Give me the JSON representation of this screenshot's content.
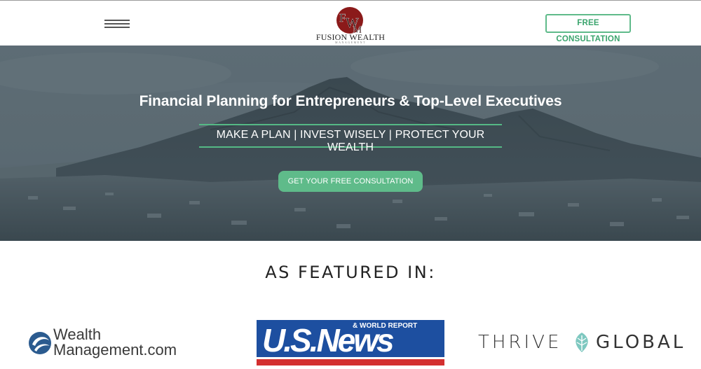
{
  "header": {
    "menu_icon": "hamburger-menu-icon",
    "logo": {
      "monogram": "FWM",
      "name": "FUSION WEALTH",
      "subtitle": "MANAGEMENT",
      "color": "#8b1a1a"
    },
    "cta_label": "FREE CONSULTATION"
  },
  "hero": {
    "title": "Financial Planning for Entrepreneurs & Top-Level Executives",
    "tagline": "MAKE A PLAN | INVEST WISELY | PROTECT YOUR WEALTH",
    "cta_label": "GET YOUR FREE CONSULTATION",
    "accent_color": "#5fbb8a"
  },
  "featured": {
    "title": "AS FEATURED IN:",
    "logos": [
      {
        "name": "WealthManagement.com",
        "line1": "Wealth",
        "line2": "Management.com"
      },
      {
        "name": "U.S.News & World Report",
        "main": "U.S.News",
        "sub": "& WORLD REPORT"
      },
      {
        "name": "Thrive Global",
        "word1": "THRIVE",
        "word2": "GLOBAL"
      }
    ]
  }
}
